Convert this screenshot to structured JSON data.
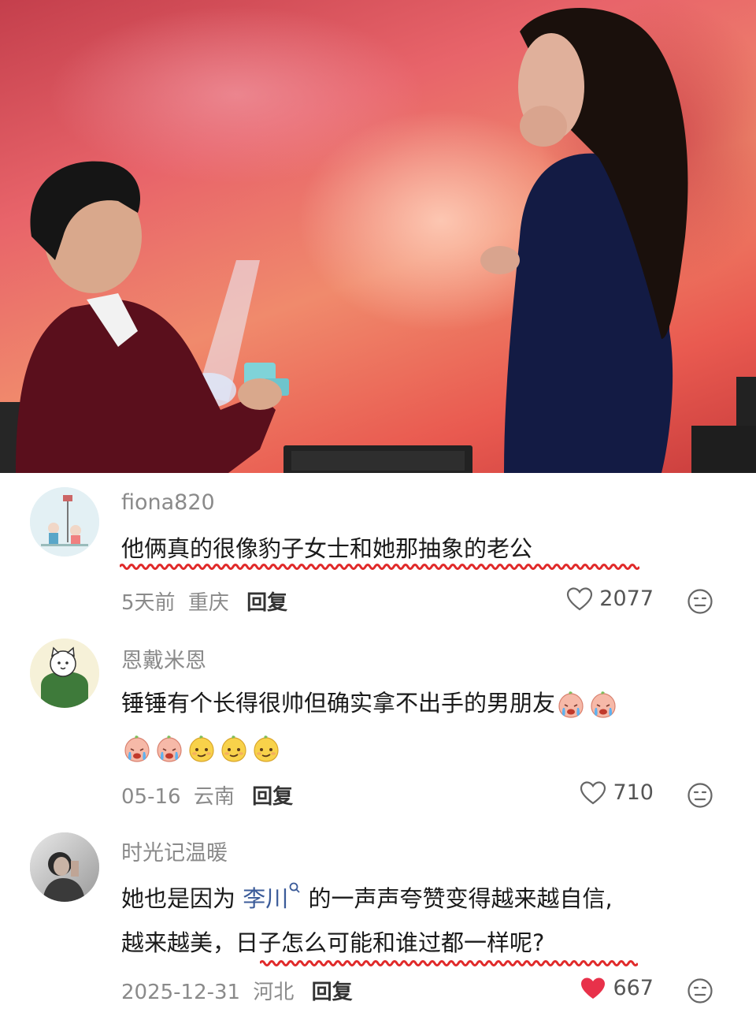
{
  "comments": [
    {
      "username": "fiona820",
      "text": "他俩真的很像豹子女士和她那抽象的老公",
      "date": "5天前",
      "location": "重庆",
      "reply_label": "回复",
      "likes": "2077",
      "liked": false
    },
    {
      "username": "恩戴米恩",
      "text": "锤锤有个长得很帅但确实拿不出手的男朋友",
      "emojis_line1": [
        "crying-peach-emoji",
        "crying-peach-emoji"
      ],
      "emojis_line2": [
        "crying-peach-emoji",
        "crying-peach-emoji",
        "smirk-face-emoji",
        "smirk-face-emoji",
        "smirk-face-emoji"
      ],
      "date": "05-16",
      "location": "云南",
      "reply_label": "回复",
      "likes": "710",
      "liked": false
    },
    {
      "username": "时光记温暖",
      "text_before": "她也是因为 ",
      "mention": "李川",
      "text_after_line1": " 的一声声夸赞变得越来越自信,",
      "text_line2": "越来越美，日子怎么可能和谁过都一样呢?",
      "date": "2025-12-31",
      "location": "河北",
      "reply_label": "回复",
      "likes": "667",
      "liked": true
    }
  ],
  "colors": {
    "like_active": "#e8314a",
    "wavy_underline": "#e02a2a",
    "mention": "#3b5b99"
  }
}
